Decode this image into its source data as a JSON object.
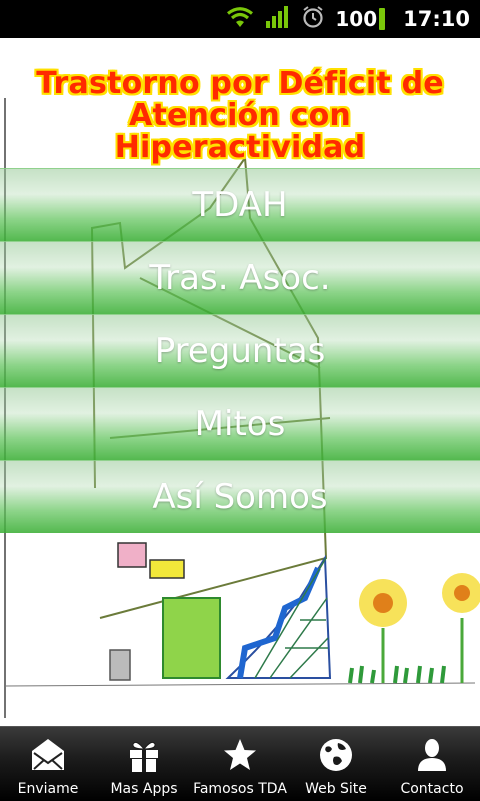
{
  "status_bar": {
    "battery": "100",
    "time": "17:10",
    "icons": [
      "wifi-icon",
      "signal-icon",
      "alarm-icon",
      "battery-icon"
    ]
  },
  "header": {
    "title_line1": "Trastorno por Déficit de",
    "title_line2": "Atención con Hiperactividad"
  },
  "menu": {
    "items": [
      {
        "label": "TDAH"
      },
      {
        "label": "Tras. Asoc."
      },
      {
        "label": "Preguntas"
      },
      {
        "label": "Mitos"
      },
      {
        "label": "Así Somos"
      }
    ]
  },
  "tabbar": {
    "tabs": [
      {
        "label": "Enviame",
        "icon": "envelope-icon"
      },
      {
        "label": "Mas Apps",
        "icon": "gift-icon"
      },
      {
        "label": "Famosos TDA",
        "icon": "star-icon"
      },
      {
        "label": "Web Site",
        "icon": "globe-icon"
      },
      {
        "label": "Contacto",
        "icon": "person-icon"
      }
    ]
  },
  "colors": {
    "title_fill": "#ff2a00",
    "title_outline": "#ffe000",
    "menu_green": "#3caf37",
    "status_bg": "#000000",
    "battery_green": "#7ac70a"
  }
}
